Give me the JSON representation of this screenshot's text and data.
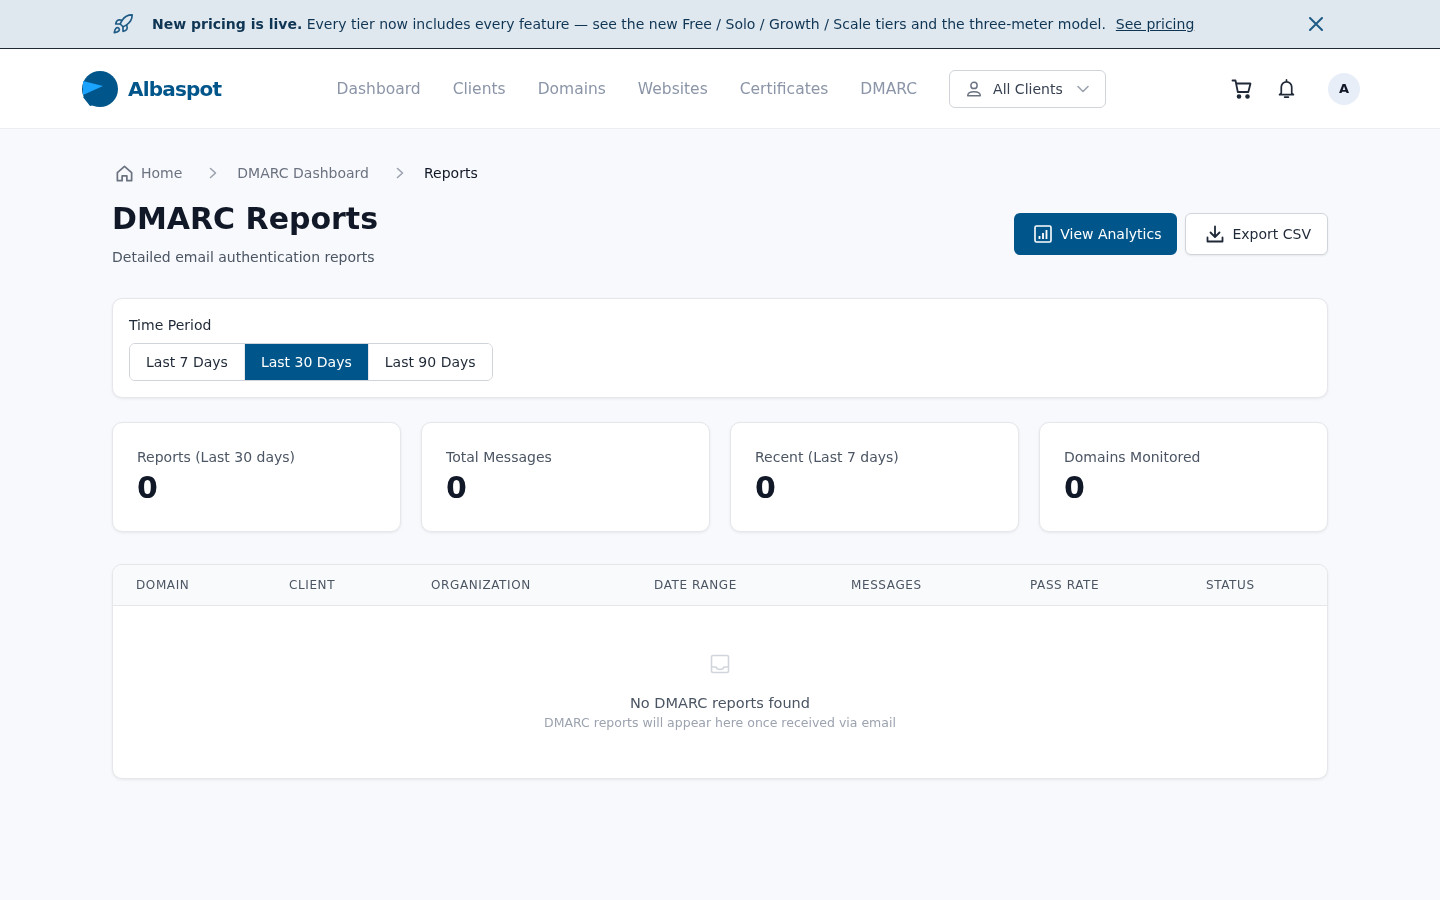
{
  "banner": {
    "message": "**New pricing is live.** Every tier now includes every feature — see the new Free / Solo / Growth / Scale tiers and the three-meter model.",
    "link": "See pricing"
  },
  "header": {
    "logo": "Albaspot",
    "nav": [
      "Dashboard",
      "Clients",
      "Domains",
      "Websites",
      "Certificates",
      "DMARC"
    ],
    "client_picker": {
      "value": "All Clients"
    },
    "avatar": "A"
  },
  "breadcrumbs": [
    {
      "label": "Home",
      "current": false
    },
    {
      "label": "DMARC Dashboard",
      "current": false
    },
    {
      "label": "Reports",
      "current": true
    }
  ],
  "page": {
    "title": "DMARC Reports",
    "subtitle": "Detailed email authentication reports",
    "actions": [
      {
        "label": "View Analytics",
        "kind": "primary"
      },
      {
        "label": "Export CSV",
        "kind": "secondary"
      }
    ]
  },
  "time_period": {
    "label": "Time Period",
    "options": [
      {
        "label": "Last 7 Days",
        "selected": false
      },
      {
        "label": "Last 30 Days",
        "selected": true
      },
      {
        "label": "Last 90 Days",
        "selected": false
      }
    ]
  },
  "stats": [
    {
      "label": "Reports (Last 30 days)",
      "value": "0"
    },
    {
      "label": "Total Messages",
      "value": "0"
    },
    {
      "label": "Recent (Last 7 days)",
      "value": "0"
    },
    {
      "label": "Domains Monitored",
      "value": "0"
    }
  ],
  "table": {
    "columns": [
      "DOMAIN",
      "CLIENT",
      "ORGANIZATION",
      "DATE RANGE",
      "MESSAGES",
      "PASS RATE",
      "STATUS"
    ],
    "empty": {
      "title": "No DMARC reports found",
      "message": "DMARC reports will appear here once received via email"
    }
  }
}
